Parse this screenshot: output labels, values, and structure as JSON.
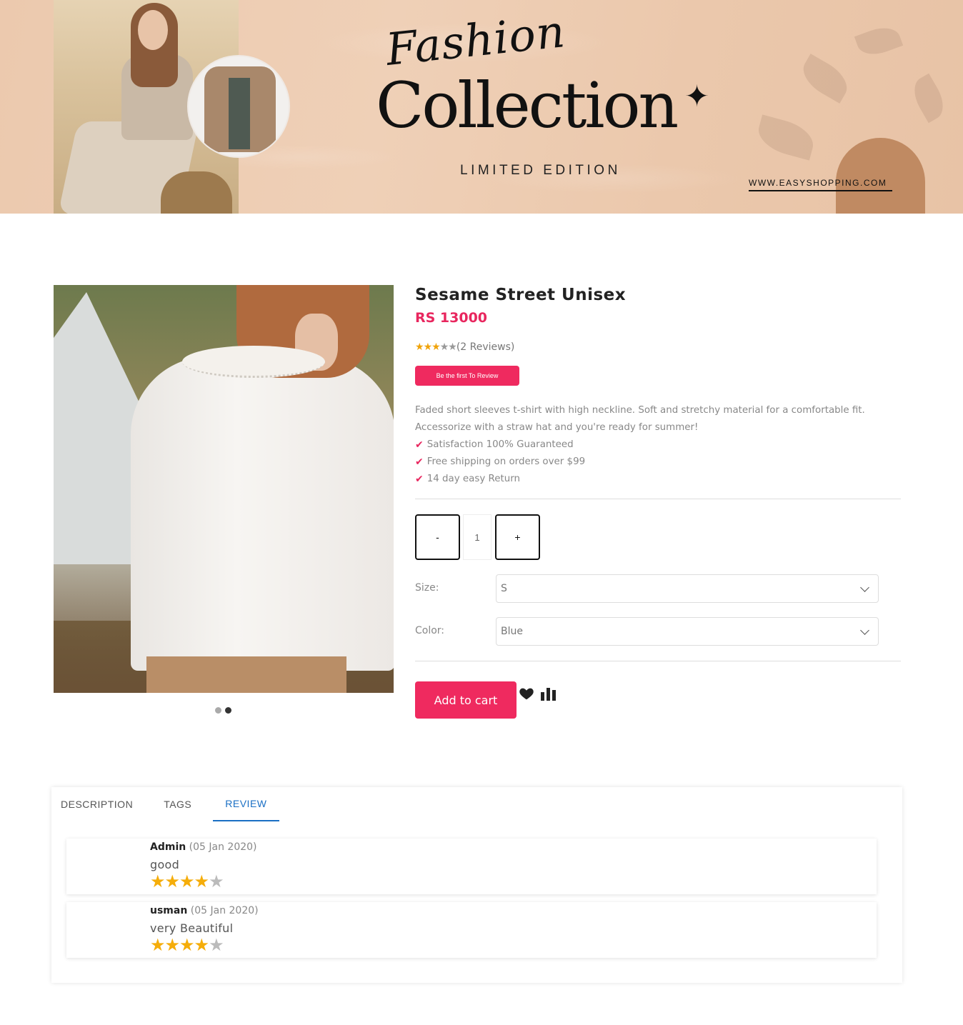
{
  "banner": {
    "script_text": "Fashion",
    "title": "Collection",
    "subtitle": "LIMITED EDITION",
    "url": "WWW.EASYSHOPPING.COM"
  },
  "product": {
    "title": "Sesame Street Unisex",
    "price": "RS 13000",
    "rating": {
      "value": 3,
      "max": 5,
      "reviews_text": "(2 Reviews)"
    },
    "review_button": "Be the first To Review",
    "description": "Faded short sleeves t-shirt with high neckline. Soft and stretchy material for a comfortable fit. Accessorize with a straw hat and you're ready for summer!",
    "features": [
      "Satisfaction 100% Guaranteed",
      "Free shipping on orders over $99",
      "14 day easy Return"
    ],
    "quantity": {
      "minus": "-",
      "value": "1",
      "plus": "+"
    },
    "size": {
      "label": "Size:",
      "value": "S"
    },
    "color": {
      "label": "Color:",
      "value": "Blue"
    },
    "add_to_cart": "Add to cart",
    "image_slider": {
      "count": 2,
      "active_index": 1
    }
  },
  "tabs": {
    "items": [
      "DESCRIPTION",
      "TAGS",
      "REVIEW"
    ],
    "active": "REVIEW"
  },
  "reviews": [
    {
      "author": "Admin",
      "date": "(05 Jan 2020)",
      "text": "good",
      "rating": 4,
      "max": 5
    },
    {
      "author": "usman",
      "date": "(05 Jan 2020)",
      "text": "very Beautiful",
      "rating": 4,
      "max": 5
    }
  ],
  "colors": {
    "accent": "#ef2a5f",
    "price": "#e8265e",
    "tab_active": "#1a6fc4",
    "star": "#f5ad0a"
  },
  "icons": {
    "feature_check": "check-icon",
    "wishlist": "heart-icon",
    "compare": "compare-icon",
    "select_arrow": "chevron-down-icon"
  }
}
